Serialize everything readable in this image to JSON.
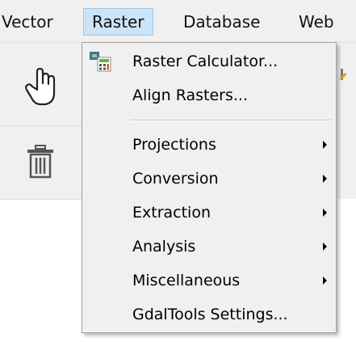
{
  "menubar": {
    "items": [
      {
        "label": "Vector"
      },
      {
        "label": "Raster"
      },
      {
        "label": "Database"
      },
      {
        "label": "Web"
      }
    ]
  },
  "toolbar": {
    "pan_icon": "hand-pan-icon",
    "delete_icon": "trash-icon"
  },
  "raster_menu": {
    "items": [
      {
        "label": "Raster Calculator...",
        "icon": "raster-calculator-icon",
        "submenu": false
      },
      {
        "label": "Align Rasters...",
        "submenu": false
      },
      {
        "label": "Projections",
        "submenu": true
      },
      {
        "label": "Conversion",
        "submenu": true
      },
      {
        "label": "Extraction",
        "submenu": true
      },
      {
        "label": "Analysis",
        "submenu": true
      },
      {
        "label": "Miscellaneous",
        "submenu": true
      },
      {
        "label": "GdalTools Settings...",
        "submenu": false
      }
    ]
  },
  "colors": {
    "menu_bg": "#f0f0f0",
    "active_bg": "#cce4f7",
    "active_border": "#99c9ef"
  }
}
